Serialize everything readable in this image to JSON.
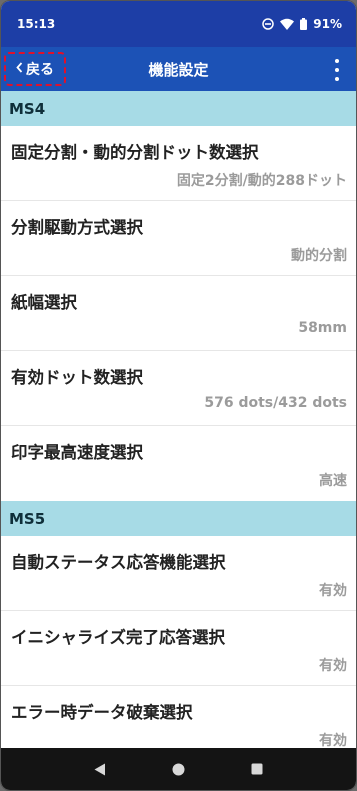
{
  "status_bar": {
    "time": "15:13",
    "battery": "91%",
    "icons": [
      "do-not-disturb-icon",
      "wifi-icon",
      "battery-icon"
    ]
  },
  "app_bar": {
    "back_label": "戻る",
    "title": "機能設定",
    "menu_icon": "more-vert-icon"
  },
  "sections": [
    {
      "title": "MS4",
      "items": [
        {
          "label": "固定分割・動的分割ドット数選択",
          "value": "固定2分割/動的288ドット"
        },
        {
          "label": "分割駆動方式選択",
          "value": "動的分割"
        },
        {
          "label": "紙幅選択",
          "value": "58mm"
        },
        {
          "label": "有効ドット数選択",
          "value": "576 dots/432 dots"
        },
        {
          "label": "印字最高速度選択",
          "value": "高速"
        }
      ]
    },
    {
      "title": "MS5",
      "items": [
        {
          "label": "自動ステータス応答機能選択",
          "value": "有効"
        },
        {
          "label": "イニシャライズ完了応答選択",
          "value": "有効"
        },
        {
          "label": "エラー時データ破棄選択",
          "value": "有効"
        }
      ]
    }
  ],
  "nav_bar": {
    "icons": [
      "back-triangle-icon",
      "home-circle-icon",
      "recents-square-icon"
    ]
  },
  "colors": {
    "status_bar": "#1d3ea6",
    "app_bar": "#1c52b6",
    "section_header": "#a7dbe6",
    "highlight": "#e0102b"
  }
}
